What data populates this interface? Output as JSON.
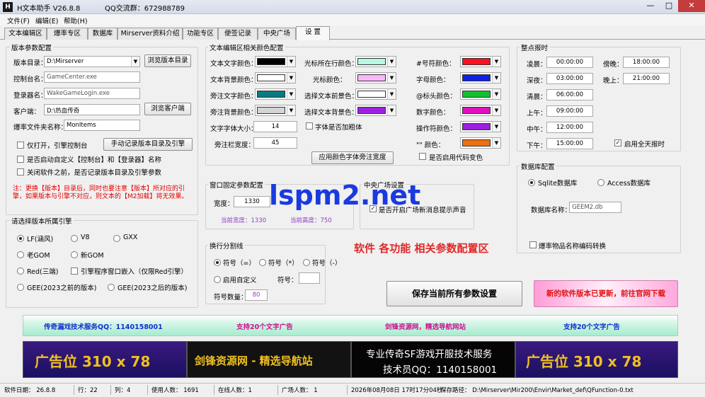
{
  "window": {
    "title": "H文本助手  V26.8.8",
    "qq_group": "QQ交流群：672988789",
    "minimize": "—",
    "maximize": "□",
    "close": "✕"
  },
  "menu": [
    "文件(F)",
    "编辑(E)",
    "帮助(H)"
  ],
  "tabs": [
    "文本编辑区",
    "爆率专区",
    "数据库",
    "Mirserver资料介绍",
    "功能专区",
    "便签记录",
    "中央广场",
    "设  置"
  ],
  "source": {
    "title": "版本参数配置",
    "version_dir_label": "版本目录：",
    "version_dir_value": "D:\\Mirserver",
    "browse_dir": "浏览版本目录",
    "console_label": "控制台名：",
    "console_value": "GameCenter.exe",
    "login_label": "登录器名：",
    "login_value": "WakeGameLogin.exe",
    "client_label": "客户端：",
    "client_value": "D:\\热血传奇",
    "browse_client": "浏览客户端",
    "drop_label": "爆率文件夹名称：",
    "drop_value": "MonItems",
    "only_open": "仅打开，引擎控制台",
    "manual_btn": "手动记录版本目录及引擎",
    "auto_start": "是否启动自定义【控制台】和【登录器】名称",
    "remember": "关闭软件之前，是否记录版本目录及引擎参数",
    "note": "注：更换【版本】目录后，同时也要注意【版本】所对应的引擎，如果版本与引擎不对应，则文本的【M2加载】将无效果。"
  },
  "engine": {
    "title": "请选择版本所属引擎",
    "options": [
      "LF(涵风)",
      "V8",
      "GXX",
      "老GOM",
      "新GOM",
      "Red(三端)",
      "GEE(2023之前的版本)",
      "GEE(2023之后的版本)"
    ],
    "embed": "引擎程序窗口嵌入（仅限Red引擎）"
  },
  "colors": {
    "title": "文本编辑区相关颜色配置",
    "col1": [
      "文本文字颜色：",
      "文本背景颜色：",
      "旁注文字颜色：",
      "旁注背景颜色："
    ],
    "col1_colors": [
      "#000000",
      "#ffffff",
      "#0a7a80",
      "#d4d4d4"
    ],
    "col2": [
      "光标所在行颜色：",
      "光标颜色：",
      "选择文本前景色：",
      "选择文本背景色："
    ],
    "col2_colors": [
      "#b8f8e0",
      "#f8b8f8",
      "#ffffff",
      "#9b20e0"
    ],
    "col3": [
      "#号符颜色：",
      "字母颜色：",
      "@标头颜色：",
      "数字颜色：",
      "操作符颜色：",
      "\"\" 颜色："
    ],
    "col3_colors": [
      "#ff1020",
      "#1020e8",
      "#10c030",
      "#e010c0",
      "#9b20e0",
      "#ee7010"
    ],
    "font_size_label": "文字字体大小：",
    "font_size": "14",
    "bold_label": "字体是否加粗体",
    "side_width_label": "旁注栏宽度：",
    "side_width": "45",
    "apply_btn": "应用颜色字体旁注宽度",
    "web_color": "是否启用代码变色"
  },
  "window_size": {
    "title": "窗口固定参数配置",
    "width_label": "宽度：",
    "width_value": "1330",
    "cur_width": "当前宽度：1330",
    "cur_height": "当前高度：750"
  },
  "central": {
    "title": "中央广场设置",
    "msg": "是否开启广场新消息提示声音"
  },
  "watermark": "lspm2.net",
  "caption": "软件 各功能 相关参数配置区",
  "separator": {
    "title": "换行分割线",
    "r1": "符号（=）",
    "r2": "符号（*）",
    "r3": "符号（-）",
    "custom": "启用自定义",
    "symbol_label": "符号：",
    "count_label": "符号数量：",
    "count": "80"
  },
  "timer": {
    "title": "整点报时",
    "rows": [
      [
        "凌晨：",
        "00:00:00",
        "傍晚：",
        "18:00:00"
      ],
      [
        "深夜：",
        "03:00:00",
        "晚上：",
        "21:00:00"
      ],
      [
        "清晨：",
        "06:00:00"
      ],
      [
        "上午：",
        "09:00:00"
      ],
      [
        "中午：",
        "12:00:00"
      ],
      [
        "下午：",
        "15:00:00"
      ]
    ],
    "all_day": "启用全天报时"
  },
  "db": {
    "title": "数据库配置",
    "sqlite": "Sqlite数据库",
    "access": "Access数据库",
    "name_label": "数据库名称：",
    "name_value": "GEEM2.db",
    "convert": "爆率物品名称编码转换"
  },
  "save_btn": "保存当前所有参数设置",
  "update_btn": "新的软件版本已更新，前往官网下载",
  "ads_text": [
    "传奇漏戏技术服务QQ：1140158001",
    "支持20个文字广告",
    "剑锋资源网，精选导航网站",
    "支持20个文字广告"
  ],
  "ads_banner": [
    "广告位   310 x 78",
    "剑锋资源网 - 精选导航站",
    "专业传奇SF游戏开服技术服务",
    "技术员QQ：1140158001",
    "广告位   310 x 78"
  ],
  "status": {
    "date": "软件日期：  26.8.8",
    "row": "行：22",
    "col": "列：4",
    "users": "使用人数：  1691",
    "online": "在线人数：1",
    "square": "广场人数：  1",
    "time": "2026年08月08日 17时17分04秒",
    "path": "保存路径：  D:\\Mirserver\\Mir200\\Envir\\Market_def\\QFunction-0.txt"
  }
}
